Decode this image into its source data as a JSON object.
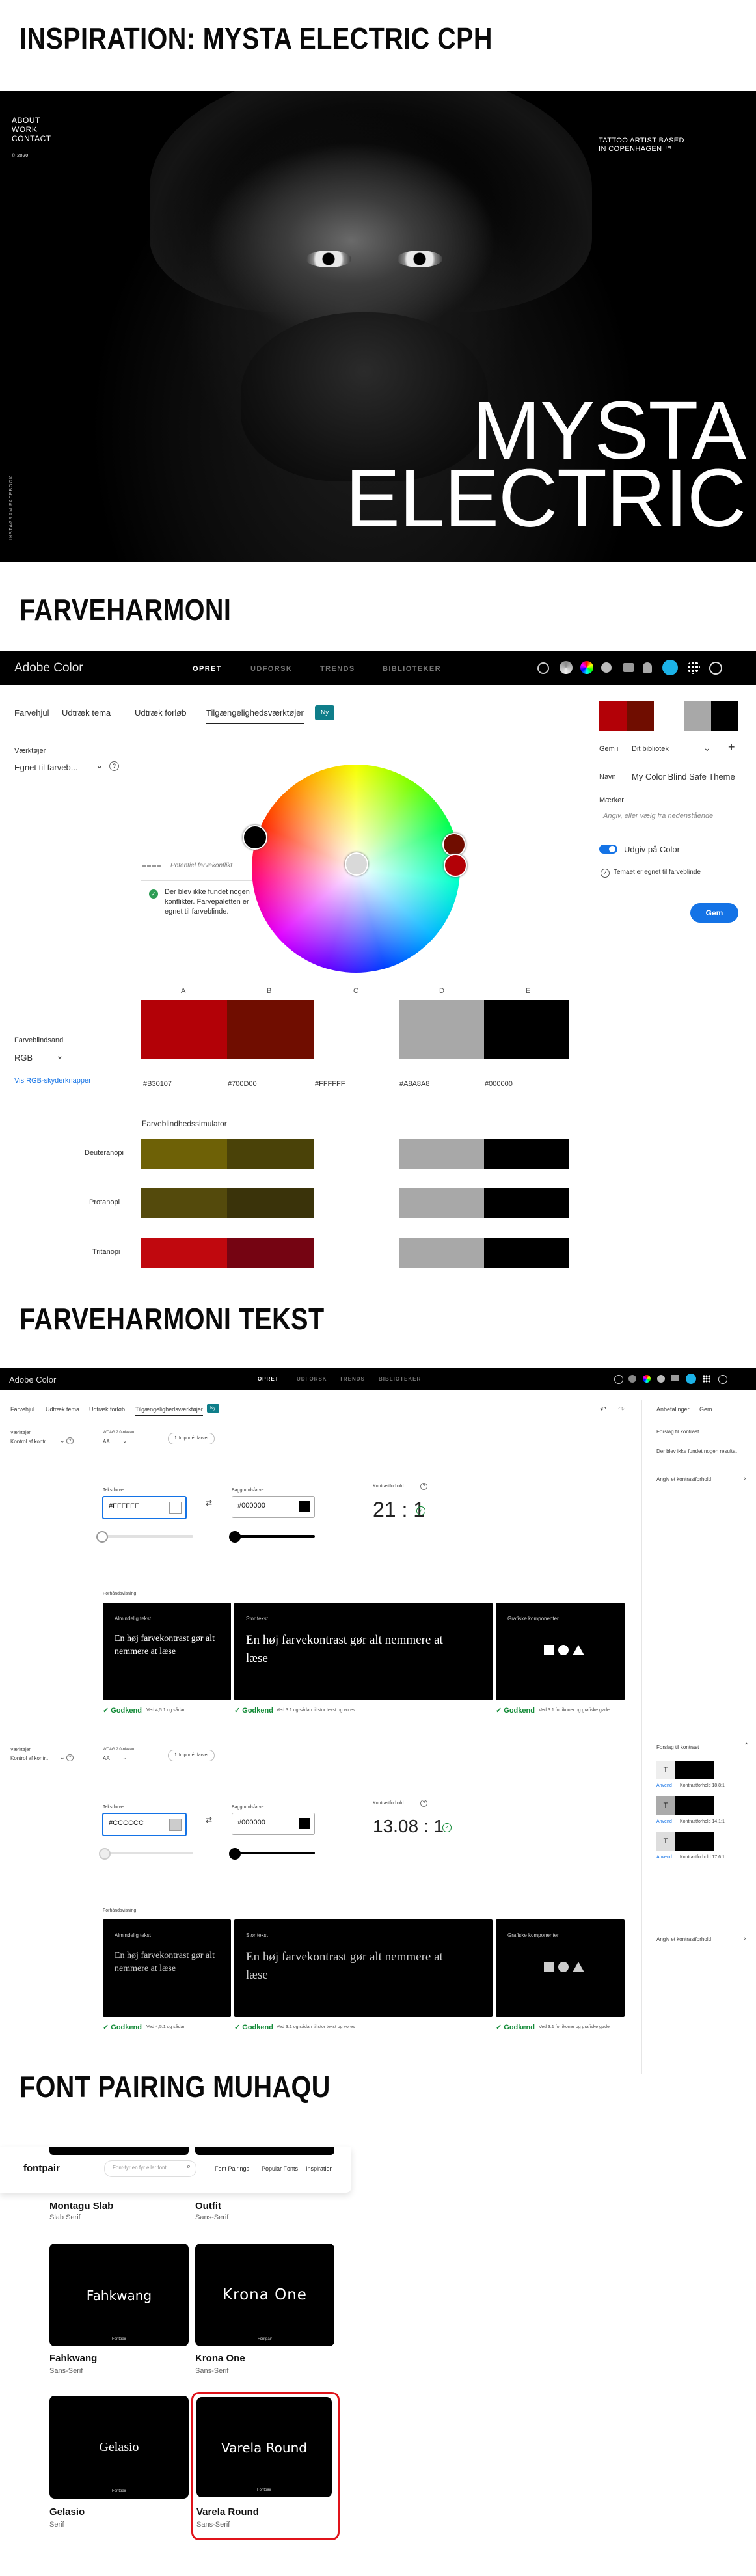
{
  "sections": {
    "s1": "INSPIRATION: MYSTA ELECTRIC CPH",
    "s2": "FARVEHARMONI",
    "s3": "FARVEHARMONI TEKST",
    "s4": "FONT PAIRING MUHAQU"
  },
  "hero": {
    "nav": [
      "ABOUT",
      "WORK",
      "CONTACT"
    ],
    "year": "© 2020",
    "tagline_1": "TATTOO ARTIST BASED",
    "tagline_2": "IN COPENHAGEN ™",
    "social": "INSTAGRAM    FACEBOOK",
    "brand_1": "MYSTA",
    "brand_2": "ELECTRIC"
  },
  "adobe": {
    "logo": "Adobe Color",
    "nav": [
      "OPRET",
      "UDFORSK",
      "TRENDS",
      "BIBLIOTEKER"
    ],
    "tabs": [
      "Farvehjul",
      "Udtræk tema",
      "Udtræk forløb",
      "Tilgængelighedsværktøjer"
    ],
    "new_badge": "Ny",
    "tools_label": "Værktøjer",
    "tools_value": "Egnet til farveb...",
    "conflict_label": "Potentiel farvekonflikt",
    "conflict_msg": "Der blev ikke fundet nogen konflikter. Farvepaletten er egnet til farveblinde.",
    "colormode_label": "Farveblindsand",
    "colormode_value": "RGB",
    "link": "Vis RGB-skyderknapper",
    "letters": [
      "A",
      "B",
      "C",
      "D",
      "E"
    ],
    "hexes": [
      "#B30107",
      "#700D00",
      "#FFFFFF",
      "#A8A8A8",
      "#000000"
    ],
    "sim_title": "Farveblindhedssimulator",
    "sims": [
      "Deuteranopi",
      "Protanopi",
      "Tritanopi"
    ],
    "side": {
      "save_to_label": "Gem i",
      "save_to_value": "Dit bibliotek",
      "name_label": "Navn",
      "name_value": "My Color Blind Safe Theme",
      "tags_label": "Mærker",
      "tags_placeholder": "Angiv, eller vælg fra nedenstående",
      "publish_label": "Udgiv på Color",
      "check_label": "Temaet er egnet til farveblinde",
      "save_button": "Gem"
    },
    "colors": {
      "a": "#B30107",
      "b": "#700D00",
      "c": "#FFFFFF",
      "d": "#A8A8A8",
      "e": "#000000",
      "deu_a": "#6E6106",
      "deu_b": "#4A4208",
      "pro_a": "#544A0C",
      "pro_b": "#3A330A",
      "tri_a": "#C0080E",
      "tri_b": "#750412"
    }
  },
  "contrast": {
    "logo": "Adobe Color",
    "nav": [
      "OPRET",
      "UDFORSK",
      "TRENDS",
      "BIBLIOTEKER"
    ],
    "tabs": [
      "Farvehjul",
      "Udtræk tema",
      "Udtræk forløb",
      "Tilgængelighedsværktøjer"
    ],
    "new_badge": "Ny",
    "side_tabs": [
      "Anbefalinger",
      "Gem"
    ],
    "side_sug_1": "Forslag til kontrast",
    "side_none": "Der blev ikke fundet nogen resultat",
    "side_enter": "Angiv et kontrastforhold",
    "side_sug_2": "Forslag til kontrast",
    "side_items": [
      {
        "tag": "Anvend",
        "ratio": "Kontrastforhold 18,8:1"
      },
      {
        "tag": "Anvend",
        "ratio": "Kontrastforhold 14,1:1"
      },
      {
        "tag": "Anvend",
        "ratio": "Kontrastforhold 17,6:1"
      }
    ],
    "blocks": [
      {
        "tool_label": "Værktøjer",
        "tool_value": "Kontrol af kontr...",
        "wcag_label": "WCAG 2.0-niveau",
        "wcag_value": "AA",
        "import_btn": "Importér farver",
        "text_label": "Tekstfarve",
        "text_value": "#FFFFFF",
        "text_color": "#FFFFFF",
        "bg_label": "Baggrundsfarve",
        "bg_value": "#000000",
        "bg_color": "#000000",
        "ratio_label": "Kontrastforhold",
        "ratio": "21 : 1",
        "preview_title": "Forhåndsvisning",
        "p1_cap": "Almindelig tekst",
        "p1_text": "En høj farvekontrast gør alt nemmere at læse",
        "p2_cap": "Stor tekst",
        "p2_text": "En høj farvekontrast gør alt nemmere at læse",
        "p3_cap": "Grafiske komponenter",
        "pass": "Godkend",
        "pass_1": "Ved 4,5:1 og sådan",
        "pass_2": "Ved 3:1 og sådan til stor tekst og vores",
        "pass_3": "Ved 3:1 for ikoner og grafiske gøde"
      },
      {
        "tool_label": "Værktøjer",
        "tool_value": "Kontrol af kontr...",
        "wcag_label": "WCAG 2.0-niveau",
        "wcag_value": "AA",
        "import_btn": "Importér farver",
        "text_label": "Tekstfarve",
        "text_value": "#CCCCCC",
        "text_color": "#CCCCCC",
        "bg_label": "Baggrundsfarve",
        "bg_value": "#000000",
        "bg_color": "#000000",
        "ratio_label": "Kontrastforhold",
        "ratio": "13.08 : 1",
        "preview_title": "Forhåndsvisning",
        "p1_cap": "Almindelig tekst",
        "p1_text": "En høj farvekontrast gør alt nemmere at læse",
        "p2_cap": "Stor tekst",
        "p2_text": "En høj farvekontrast gør alt nemmere at læse",
        "p3_cap": "Grafiske komponenter",
        "pass": "Godkend",
        "pass_1": "Ved 4,5:1 og sådan",
        "pass_2": "Ved 3:1 og sådan til stor tekst og vores",
        "pass_3": "Ved 3:1 for ikoner og grafiske gøde"
      }
    ]
  },
  "fontpair": {
    "logo": "fontpair",
    "search_placeholder": "Font-fyr en fyr eller font",
    "nav": [
      "Font Pairings",
      "Popular Fonts",
      "Inspiration"
    ],
    "cards": [
      {
        "name": "Montagu Slab",
        "cat": "Slab Serif",
        "preview": ""
      },
      {
        "name": "Outfit",
        "cat": "Sans-Serif",
        "preview": ""
      },
      {
        "name": "Fahkwang",
        "cat": "Sans-Serif",
        "preview": "Fahkwang"
      },
      {
        "name": "Krona One",
        "cat": "Sans-Serif",
        "preview": "Krona One"
      },
      {
        "name": "Gelasio",
        "cat": "Serif",
        "preview": "Gelasio"
      },
      {
        "name": "Varela Round",
        "cat": "Sans-Serif",
        "preview": "Varela Round"
      }
    ],
    "card_foot": "Fontpair",
    "highlight_color": "#E0131A"
  }
}
